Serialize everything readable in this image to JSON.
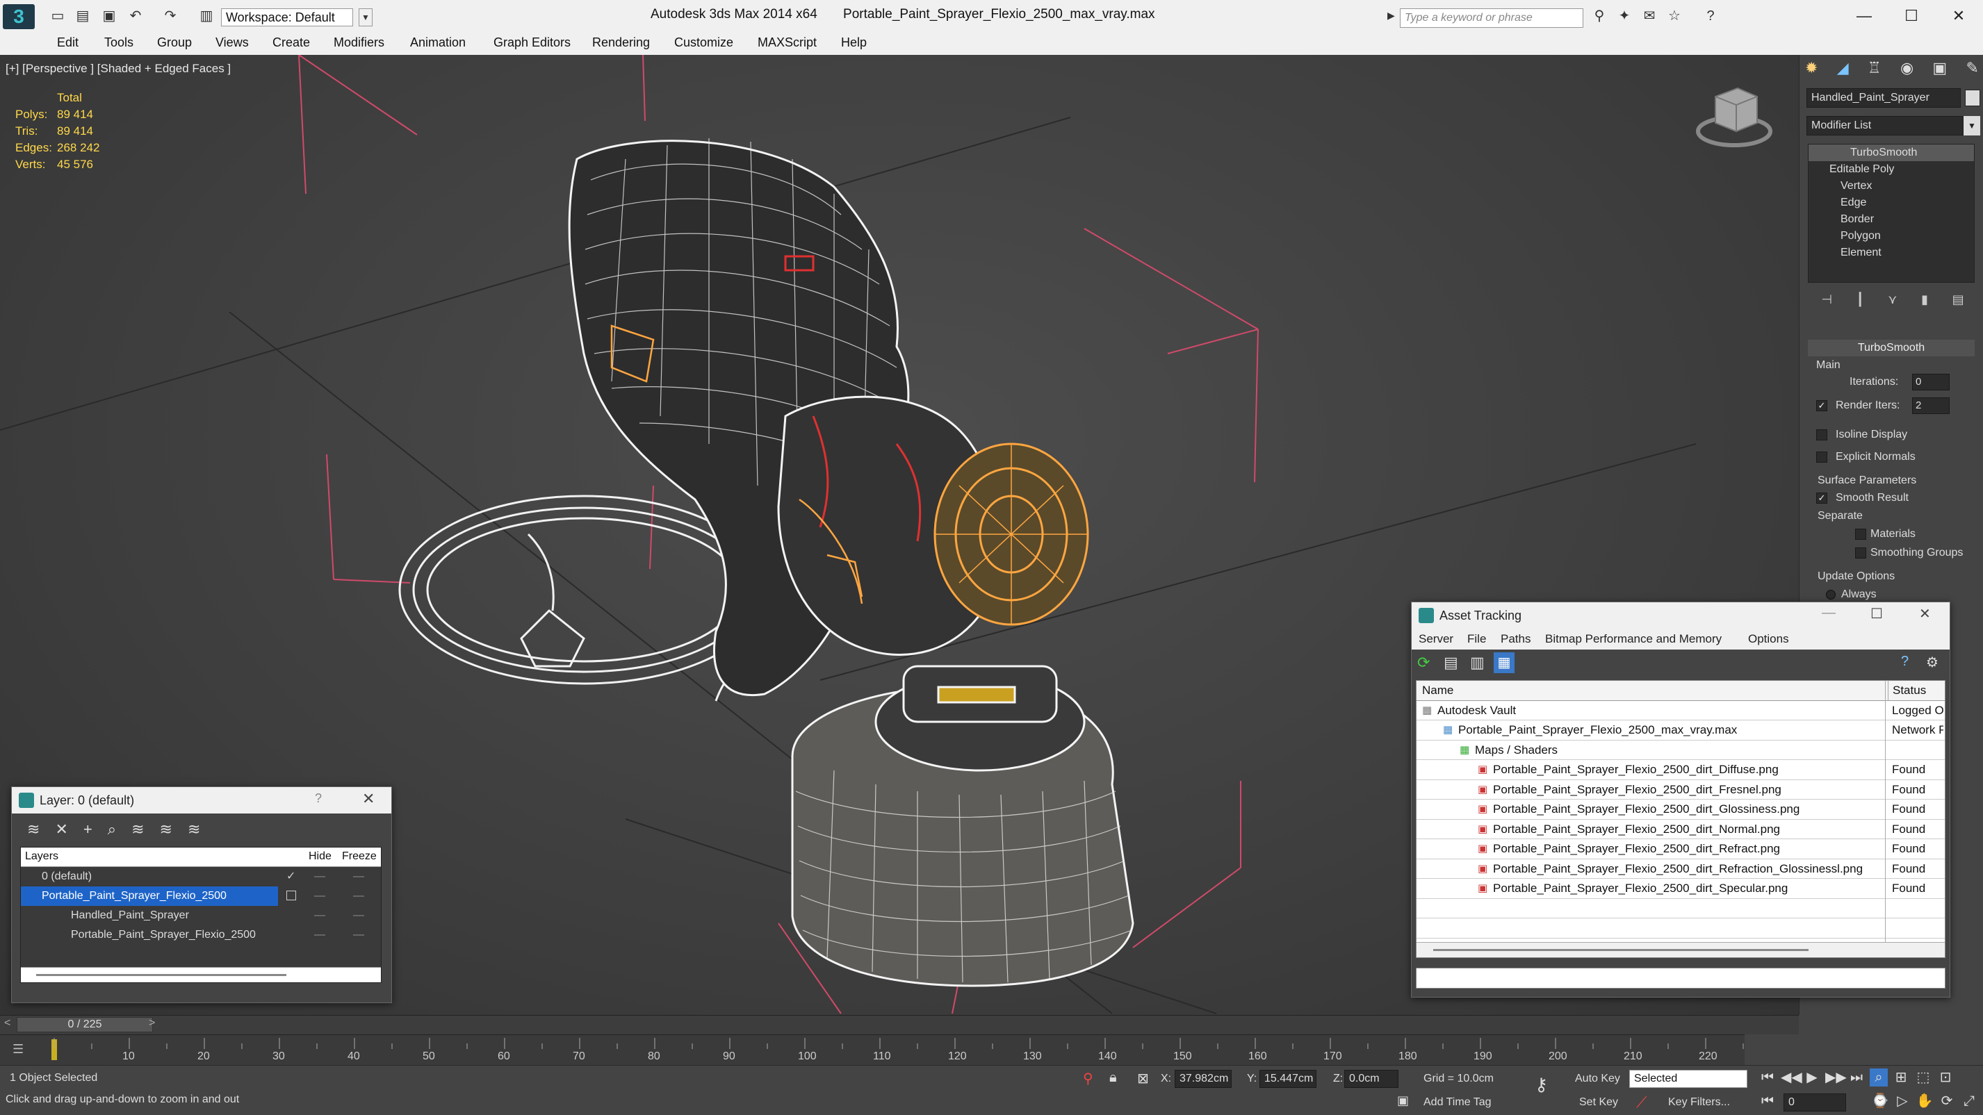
{
  "titlebar": {
    "workspace": "Workspace: Default",
    "app": "Autodesk 3ds Max  2014 x64",
    "file": "Portable_Paint_Sprayer_Flexio_2500_max_vray.max",
    "search_placeholder": "Type a keyword or phrase"
  },
  "menu": [
    "Edit",
    "Tools",
    "Group",
    "Views",
    "Create",
    "Modifiers",
    "Animation",
    "Graph Editors",
    "Rendering",
    "Customize",
    "MAXScript",
    "Help"
  ],
  "viewport": {
    "label": "[+] [Perspective ] [Shaded + Edged Faces ]",
    "stats": {
      "header": "Total",
      "polys_label": "Polys:",
      "polys": "89 414",
      "tris_label": "Tris:",
      "tris": "89 414",
      "edges_label": "Edges:",
      "edges": "268 242",
      "verts_label": "Verts:",
      "verts": "45 576"
    }
  },
  "cmdpanel": {
    "object_name": "Handled_Paint_Sprayer",
    "modifier_list": "Modifier List",
    "stack": [
      "TurboSmooth",
      "Editable Poly",
      "Vertex",
      "Edge",
      "Border",
      "Polygon",
      "Element"
    ],
    "rollout": "TurboSmooth",
    "main": "Main",
    "iterations_label": "Iterations:",
    "iterations": "0",
    "render_iters_label": "Render Iters:",
    "render_iters": "2",
    "isoline": "Isoline Display",
    "explicit_normals": "Explicit Normals",
    "surface_params": "Surface Parameters",
    "smooth_result": "Smooth Result",
    "separate": "Separate",
    "materials": "Materials",
    "smoothing_groups": "Smoothing Groups",
    "update_options": "Update Options",
    "always": "Always"
  },
  "layer_dialog": {
    "title": "Layer: 0 (default)",
    "help": "?",
    "col_layers": "Layers",
    "col_hide": "Hide",
    "col_freeze": "Freeze",
    "rows": [
      "0 (default)",
      "Portable_Paint_Sprayer_Flexio_2500",
      "Handled_Paint_Sprayer",
      "Portable_Paint_Sprayer_Flexio_2500"
    ]
  },
  "asset_dialog": {
    "title": "Asset Tracking",
    "menu": [
      "Server",
      "File",
      "Paths",
      "Bitmap Performance and Memory",
      "Options"
    ],
    "col_name": "Name",
    "col_status": "Status",
    "rows": [
      {
        "name": "Autodesk Vault",
        "status": "Logged Ou"
      },
      {
        "name": "Portable_Paint_Sprayer_Flexio_2500_max_vray.max",
        "status": "Network P"
      },
      {
        "name": "Maps / Shaders",
        "status": ""
      },
      {
        "name": "Portable_Paint_Sprayer_Flexio_2500_dirt_Diffuse.png",
        "status": "Found"
      },
      {
        "name": "Portable_Paint_Sprayer_Flexio_2500_dirt_Fresnel.png",
        "status": "Found"
      },
      {
        "name": "Portable_Paint_Sprayer_Flexio_2500_dirt_Glossiness.png",
        "status": "Found"
      },
      {
        "name": "Portable_Paint_Sprayer_Flexio_2500_dirt_Normal.png",
        "status": "Found"
      },
      {
        "name": "Portable_Paint_Sprayer_Flexio_2500_dirt_Refract.png",
        "status": "Found"
      },
      {
        "name": "Portable_Paint_Sprayer_Flexio_2500_dirt_Refraction_Glossinessl.png",
        "status": "Found"
      },
      {
        "name": "Portable_Paint_Sprayer_Flexio_2500_dirt_Specular.png",
        "status": "Found"
      }
    ]
  },
  "timeline": {
    "frame": "0 / 225",
    "ticks": [
      "10",
      "20",
      "30",
      "40",
      "50",
      "60",
      "70",
      "80",
      "90",
      "100",
      "110",
      "120",
      "130",
      "140",
      "150",
      "160",
      "170",
      "180",
      "190",
      "200",
      "210",
      "220"
    ]
  },
  "status": {
    "selected": "1 Object Selected",
    "prompt": "Click and drag up-and-down to zoom in and out",
    "x_label": "X:",
    "x": "37.982cm",
    "y_label": "Y:",
    "y": "15.447cm",
    "z_label": "Z:",
    "z": "0.0cm",
    "grid": "Grid = 10.0cm",
    "auto_key": "Auto Key",
    "selected_dropdown": "Selected",
    "set_key": "Set Key",
    "key_filters": "Key Filters...",
    "add_time_tag": "Add Time Tag",
    "frame_field": "0"
  },
  "colors": {
    "accent": "#3399ff",
    "stats": "#ffd84a",
    "wire": "#ffffff",
    "selection": "#ffa640",
    "grid_red": "#d04a6a"
  }
}
